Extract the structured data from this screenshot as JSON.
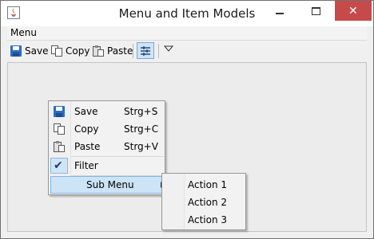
{
  "window": {
    "title": "Menu and Item Models",
    "icons": {
      "app": "java-icon",
      "minimize": "minimize-icon",
      "maximize": "maximize-icon",
      "close": "close-icon"
    }
  },
  "menubar": {
    "items": [
      {
        "label": "Menu"
      }
    ]
  },
  "toolbar": {
    "save_label": "Save",
    "copy_label": "Copy",
    "paste_label": "Paste",
    "filter_selected": true,
    "icons": {
      "save": "floppy-disk-icon",
      "copy": "copy-icon",
      "paste": "paste-icon",
      "filter": "filter-icon",
      "overflow": "chevron-down-icon"
    }
  },
  "popup_menu": {
    "items": [
      {
        "label": "Save",
        "accelerator": "Strg+S",
        "icon": "floppy-disk-icon"
      },
      {
        "label": "Copy",
        "accelerator": "Strg+C",
        "icon": "copy-icon"
      },
      {
        "label": "Paste",
        "accelerator": "Strg+V",
        "icon": "paste-icon"
      }
    ],
    "filter": {
      "label": "Filter",
      "checked": true
    },
    "submenu": {
      "label": "Sub Menu",
      "highlighted": true
    }
  },
  "submenu": {
    "items": [
      {
        "label": "Action 1"
      },
      {
        "label": "Action 2"
      },
      {
        "label": "Action 3"
      }
    ]
  },
  "colors": {
    "close_button": "#c74a4a",
    "selection": "#cde3f6",
    "selection_border": "#86b3df"
  }
}
